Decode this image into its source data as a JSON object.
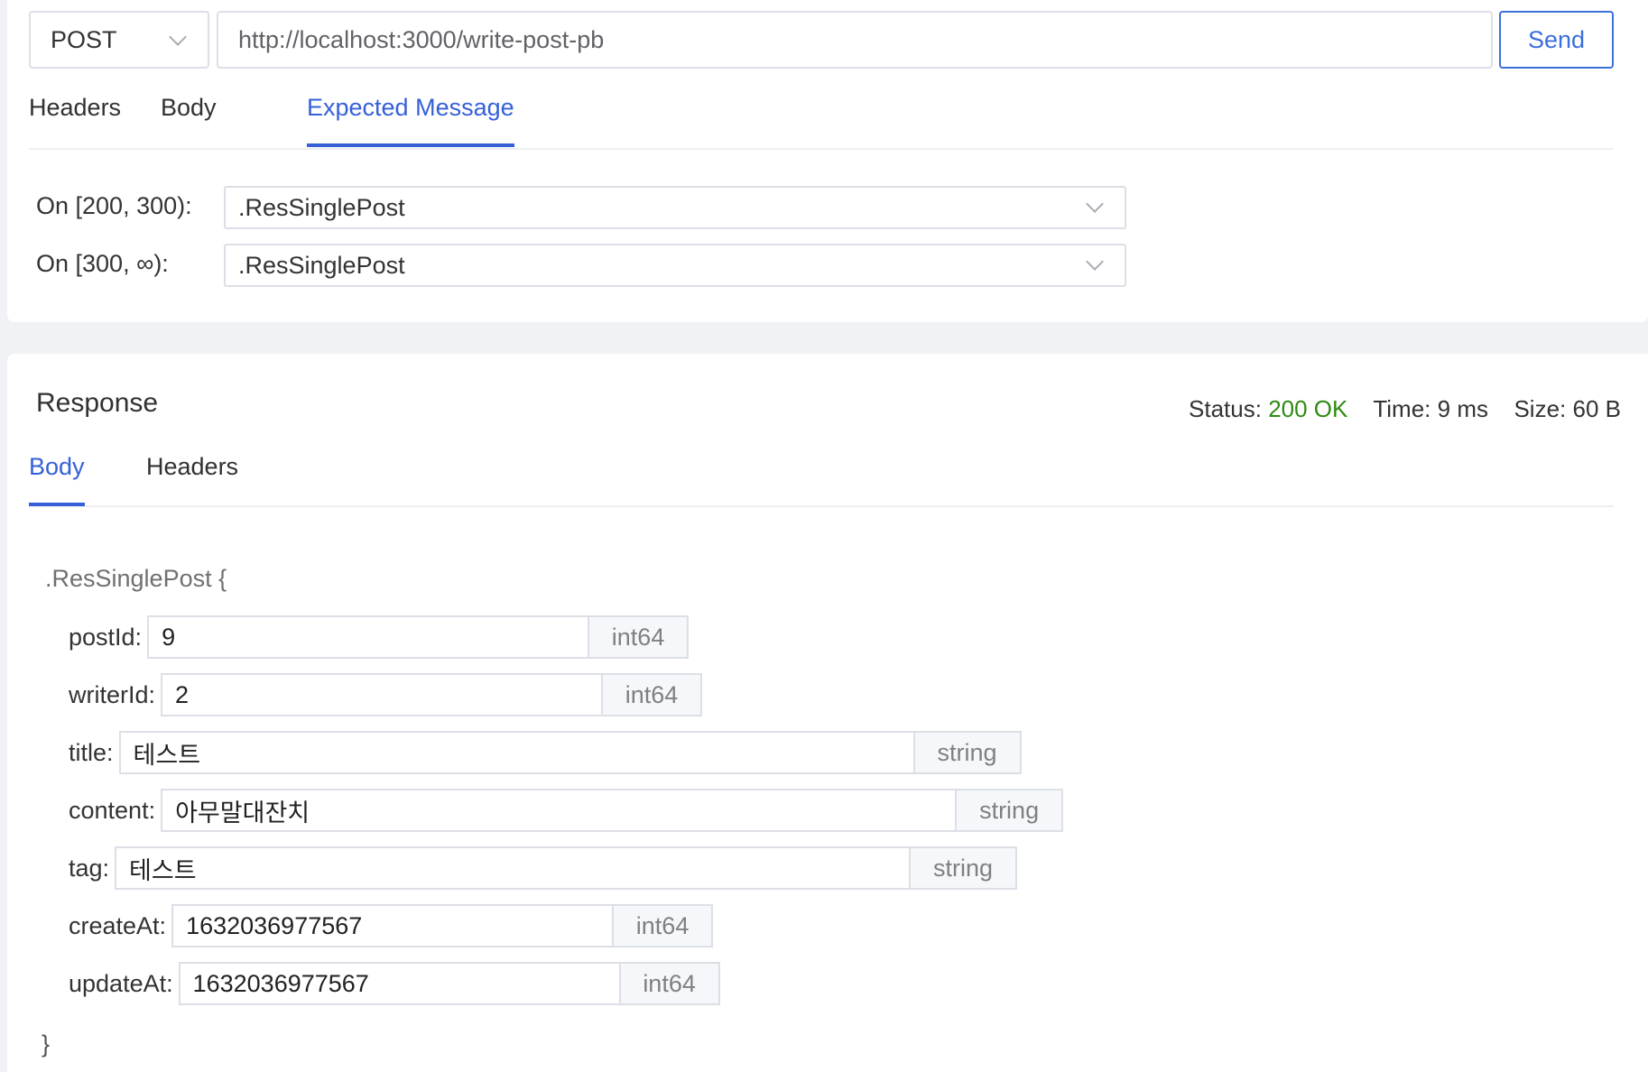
{
  "request": {
    "method": "POST",
    "url": "http://localhost:3000/write-post-pb",
    "send_label": "Send",
    "tabs": [
      "Headers",
      "Body",
      "Expected Message"
    ],
    "active_tab": "Expected Message"
  },
  "expected": {
    "rows": [
      {
        "label": "On [200, 300):",
        "value": ".ResSinglePost"
      },
      {
        "label": "On [300, ∞):",
        "value": ".ResSinglePost"
      }
    ]
  },
  "response": {
    "title": "Response",
    "status_label": "Status:",
    "status_value": "200 OK",
    "time_label": "Time:",
    "time_value": "9 ms",
    "size_label": "Size:",
    "size_value": "60 B",
    "tabs": [
      "Body",
      "Headers"
    ],
    "active_tab": "Body",
    "message_open": ".ResSinglePost {",
    "message_close": "}",
    "fields": [
      {
        "label": "postId:",
        "value": "9",
        "type": "int64"
      },
      {
        "label": "writerId:",
        "value": "2",
        "type": "int64"
      },
      {
        "label": "title:",
        "value": "테스트",
        "type": "string"
      },
      {
        "label": "content:",
        "value": "아무말대잔치",
        "type": "string"
      },
      {
        "label": "tag:",
        "value": "테스트",
        "type": "string"
      },
      {
        "label": "createAt:",
        "value": "1632036977567",
        "type": "int64"
      },
      {
        "label": "updateAt:",
        "value": "1632036977567",
        "type": "int64"
      }
    ]
  },
  "colors": {
    "accent": "#3560d8",
    "status_ok": "#2e8b12"
  },
  "icons": [
    "chevron-down-icon"
  ]
}
